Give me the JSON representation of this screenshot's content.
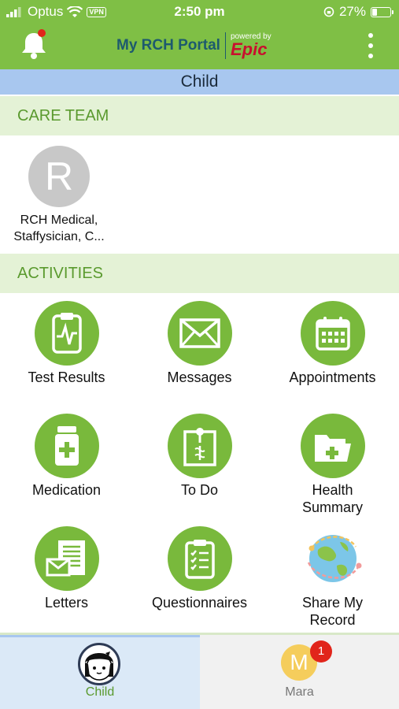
{
  "status_bar": {
    "carrier": "Optus",
    "vpn": "VPN",
    "time": "2:50 pm",
    "battery": "27%"
  },
  "header": {
    "app_name": "My RCH Portal",
    "powered_by": "powered by",
    "brand": "Epic"
  },
  "context_title": "Child",
  "care_team": {
    "heading": "CARE TEAM",
    "members": [
      {
        "initial": "R",
        "name_line1": "RCH Medical,",
        "name_line2": "Staffysician, C..."
      }
    ]
  },
  "activities": {
    "heading": "ACTIVITIES",
    "items": [
      {
        "label": "Test Results",
        "icon": "clipboard-heartbeat-icon"
      },
      {
        "label": "Messages",
        "icon": "envelope-icon"
      },
      {
        "label": "Appointments",
        "icon": "calendar-icon"
      },
      {
        "label": "Medication",
        "icon": "medicine-bottle-icon"
      },
      {
        "label": "To Do",
        "icon": "pinned-note-icon"
      },
      {
        "label_line1": "Health",
        "label_line2": "Summary",
        "icon": "medical-folder-icon"
      },
      {
        "label": "Letters",
        "icon": "letters-icon"
      },
      {
        "label": "Questionnaires",
        "icon": "checklist-clipboard-icon"
      },
      {
        "label_line1": "Share My",
        "label_line2": "Record",
        "icon": "globe-share-icon"
      }
    ]
  },
  "tabs": [
    {
      "label": "Child",
      "selected": true
    },
    {
      "label": "Mara",
      "initial": "M",
      "badge": "1"
    }
  ],
  "colors": {
    "brand_green": "#7fbf45",
    "context_blue": "#a8c7ef",
    "section_bg": "#e4f2d6",
    "section_text": "#5a9a2e",
    "badge_red": "#e1251b"
  }
}
